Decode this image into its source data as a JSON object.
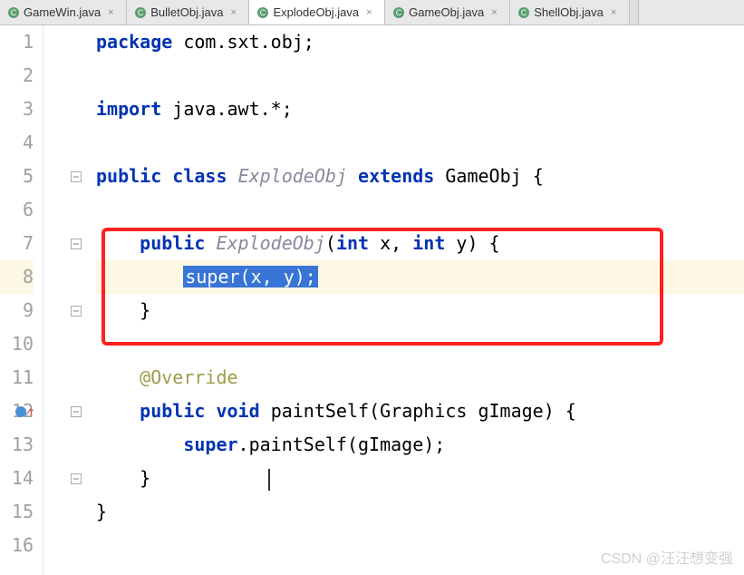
{
  "tabs": [
    {
      "label": "GameWin.java",
      "active": false
    },
    {
      "label": "BulletObj.java",
      "active": false
    },
    {
      "label": "ExplodeObj.java",
      "active": true
    },
    {
      "label": "GameObj.java",
      "active": false
    },
    {
      "label": "ShellObj.java",
      "active": false
    }
  ],
  "code": {
    "line1": {
      "kw_package": "package",
      "pkg": " com.sxt.obj;"
    },
    "line3": {
      "kw_import": "import",
      "stmt": " java.awt.*;"
    },
    "line5": {
      "kw_public": "public",
      "kw_class": "class",
      "space1": " ",
      "space2": " ",
      "cls_name": "ExplodeObj",
      "kw_extends": "extends",
      "space3": " ",
      "space4": " ",
      "parent": "GameObj",
      "brace": " {"
    },
    "line7": {
      "indent": "    ",
      "kw_public": "public",
      "space": " ",
      "ctor": "ExplodeObj",
      "params_open": "(",
      "kw_int1": "int",
      "p1": " x, ",
      "kw_int2": "int",
      "p2": " y) {"
    },
    "line8": {
      "indent": "        ",
      "selected": "super(x, y);"
    },
    "line9": {
      "indent": "    ",
      "brace": "}"
    },
    "line11": {
      "indent": "    ",
      "anno": "@Override"
    },
    "line12": {
      "indent": "    ",
      "kw_public": "public",
      "space1": " ",
      "kw_void": "void",
      "space2": " ",
      "method": "paintSelf",
      "open": "(",
      "type": "Graphics",
      "param": " gImage) {"
    },
    "line13": {
      "indent": "        ",
      "kw_super": "super",
      "call": ".paintSelf(gImage);"
    },
    "line14": {
      "indent": "    ",
      "brace": "}"
    },
    "line15": {
      "brace": "}"
    }
  },
  "line_numbers": [
    "1",
    "2",
    "3",
    "4",
    "5",
    "6",
    "7",
    "8",
    "9",
    "10",
    "11",
    "12",
    "13",
    "14",
    "15",
    "16"
  ],
  "watermark": "CSDN @汪汪想变强"
}
